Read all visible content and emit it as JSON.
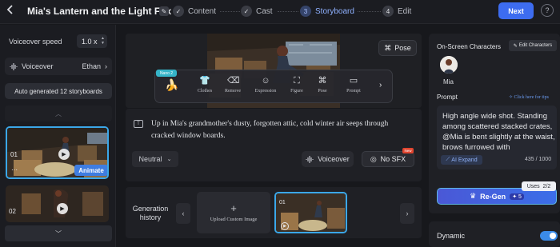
{
  "header": {
    "back_icon": "chevron-left-icon",
    "title": "Mia's Lantern and the Light Fox",
    "steps": [
      {
        "label": "Content",
        "marker": "✓",
        "state": "done"
      },
      {
        "label": "Cast",
        "marker": "✓",
        "state": "done"
      },
      {
        "label": "Storyboard",
        "marker": "3",
        "state": "active"
      },
      {
        "label": "Edit",
        "marker": "4",
        "state": "pending"
      }
    ],
    "next_label": "Next",
    "help_icon": "help-icon"
  },
  "left": {
    "voiceover_speed_label": "Voiceover speed",
    "voiceover_speed_value": "1.0 x",
    "voiceover_label": "Voiceover",
    "voiceover_value": "Ethan",
    "auto_generated_label": "Auto generated 12 storyboards",
    "storyboards": [
      {
        "number": "01",
        "selected": true,
        "animate_label": "Animate"
      },
      {
        "number": "02",
        "selected": false
      }
    ]
  },
  "center": {
    "pose_label": "Pose",
    "nano_badge": "Nano 2",
    "tools": [
      "Clothes",
      "Remove",
      "Expression",
      "Figure",
      "Pose",
      "Prompt"
    ],
    "prompt_text": "Up in Mia's grandmother's dusty, forgotten attic, cold winter air seeps through cracked window boards.",
    "emotion_value": "Neutral",
    "voiceover_button": "Voiceover",
    "sfx_button": "No SFX",
    "new_badge": "New",
    "history_label": "Generation history",
    "upload_label": "Upload Custom Image",
    "history_thumb_number": "01"
  },
  "right": {
    "onscreen_characters_label": "On-Screen Characters",
    "edit_characters_label": "Edit Characters",
    "character_name": "Mia",
    "prompt_label": "Prompt",
    "tips_link": "Click here for tips",
    "prompt_text": "High angle wide shot. Standing among scattered stacked crates, @Mia is bent slightly at the waist, brows furrowed with",
    "ai_expand_label": "AI Expand",
    "char_count": "435 / 1000",
    "regen_label": "Re-Gen",
    "regen_cost": "5",
    "uses_label": "Uses",
    "uses_value": "2/2",
    "dynamic_label": "Dynamic",
    "dynamic_enabled": true
  },
  "colors": {
    "accent": "#3d6cf0",
    "selection": "#3ba7e8",
    "background": "#17181c"
  }
}
